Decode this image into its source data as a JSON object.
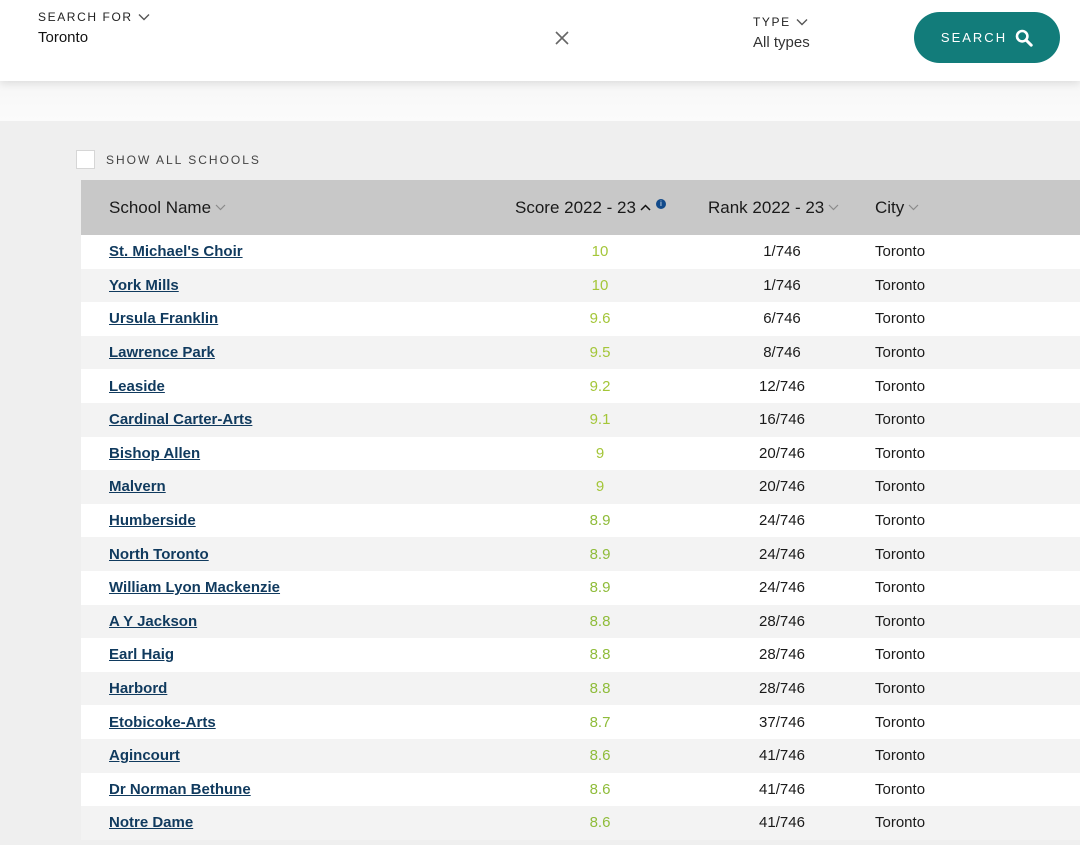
{
  "search": {
    "label": "SEARCH FOR",
    "value": "Toronto",
    "type_label": "TYPE",
    "type_value": "All types",
    "button_label": "SEARCH"
  },
  "filters": {
    "show_all_label": "SHOW ALL SCHOOLS"
  },
  "colors": {
    "accent": "#127c7a",
    "link": "#103a5e",
    "score_high": "#a4c639",
    "score_mid": "#8fbc3a",
    "header_bg": "#c8c8c8"
  },
  "table": {
    "headers": {
      "name": "School Name",
      "score": "Score 2022 - 23",
      "rank": "Rank 2022 - 23",
      "city": "City"
    },
    "rows": [
      {
        "name": "St. Michael's Choir",
        "score": "10",
        "rank": "1/746",
        "city": "Toronto"
      },
      {
        "name": "York Mills",
        "score": "10",
        "rank": "1/746",
        "city": "Toronto"
      },
      {
        "name": "Ursula Franklin",
        "score": "9.6",
        "rank": "6/746",
        "city": "Toronto"
      },
      {
        "name": "Lawrence Park",
        "score": "9.5",
        "rank": "8/746",
        "city": "Toronto"
      },
      {
        "name": "Leaside",
        "score": "9.2",
        "rank": "12/746",
        "city": "Toronto"
      },
      {
        "name": "Cardinal Carter-Arts",
        "score": "9.1",
        "rank": "16/746",
        "city": "Toronto"
      },
      {
        "name": "Bishop Allen",
        "score": "9",
        "rank": "20/746",
        "city": "Toronto"
      },
      {
        "name": "Malvern",
        "score": "9",
        "rank": "20/746",
        "city": "Toronto"
      },
      {
        "name": "Humberside",
        "score": "8.9",
        "rank": "24/746",
        "city": "Toronto"
      },
      {
        "name": "North Toronto",
        "score": "8.9",
        "rank": "24/746",
        "city": "Toronto"
      },
      {
        "name": "William Lyon Mackenzie",
        "score": "8.9",
        "rank": "24/746",
        "city": "Toronto"
      },
      {
        "name": "A Y Jackson",
        "score": "8.8",
        "rank": "28/746",
        "city": "Toronto"
      },
      {
        "name": "Earl Haig",
        "score": "8.8",
        "rank": "28/746",
        "city": "Toronto"
      },
      {
        "name": "Harbord",
        "score": "8.8",
        "rank": "28/746",
        "city": "Toronto"
      },
      {
        "name": "Etobicoke-Arts",
        "score": "8.7",
        "rank": "37/746",
        "city": "Toronto"
      },
      {
        "name": "Agincourt",
        "score": "8.6",
        "rank": "41/746",
        "city": "Toronto"
      },
      {
        "name": "Dr Norman Bethune",
        "score": "8.6",
        "rank": "41/746",
        "city": "Toronto"
      },
      {
        "name": "Notre Dame",
        "score": "8.6",
        "rank": "41/746",
        "city": "Toronto"
      }
    ]
  }
}
